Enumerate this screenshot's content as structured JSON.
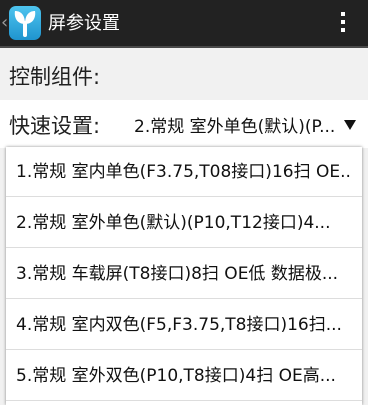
{
  "header": {
    "title": "屏参设置"
  },
  "main": {
    "section_label": "控制组件:",
    "quick_setting_label": "快速设置:",
    "quick_setting_value": "2.常规 室外单色(默认)(P..."
  },
  "dropdown": {
    "options": [
      "1.常规 室内单色(F3.75,T08接口)16扫 OE...",
      "2.常规 室外单色(默认)(P10,T12接口)4...",
      "3.常规 车载屏(T8接口)8扫 OE低 数据极...",
      "4.常规 室内双色(F5,F3.75,T8接口)16扫...",
      "5.常规 室外双色(P10,T8接口)4扫 OE高..."
    ]
  }
}
